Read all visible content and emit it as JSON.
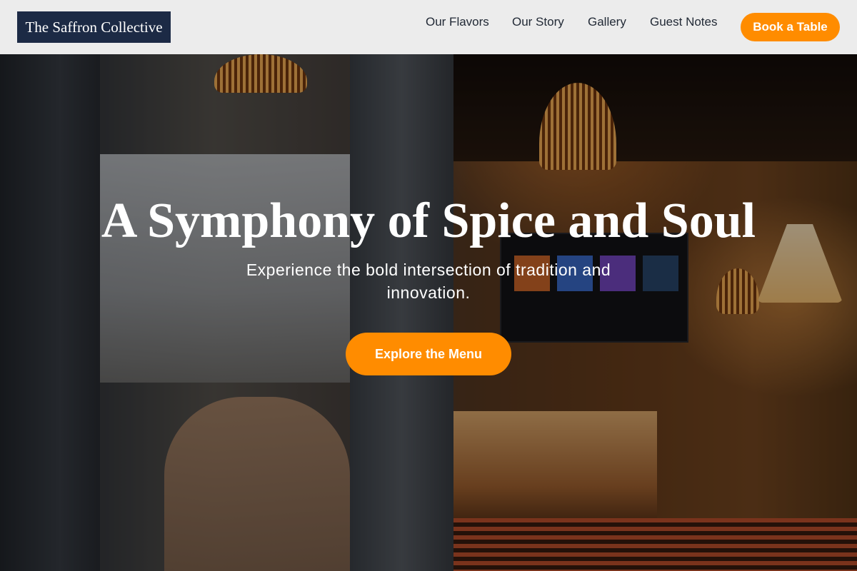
{
  "header": {
    "logo_text": "The Saffron Collective",
    "nav": [
      {
        "label": "Our Flavors"
      },
      {
        "label": "Our Story"
      },
      {
        "label": "Gallery"
      },
      {
        "label": "Guest Notes"
      }
    ],
    "cta_label": "Book a Table"
  },
  "hero": {
    "title": "A Symphony of Spice and Soul",
    "subtitle": "Experience the bold intersection of tradition and innovation.",
    "cta_label": "Explore the Menu",
    "background_image": "restaurant-interior-photo"
  },
  "colors": {
    "accent": "#ff8c00",
    "logo_bg": "#1c2a45",
    "header_bg": "#ececec",
    "nav_text": "#222a36"
  }
}
